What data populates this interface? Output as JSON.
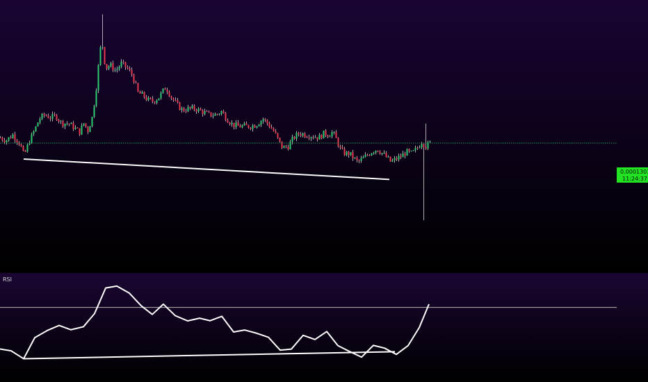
{
  "colors": {
    "bg_top": "#190433",
    "bg_bottom": "#000000",
    "rsi_bg_top": "#1a0633",
    "rsi_bg_bottom": "#000000",
    "up": "#2ecc71",
    "down": "#e8384f",
    "wick": "#d8d8d8",
    "trendline": "#ffffff",
    "price_line": "#2ecc71",
    "badge_bg": "#22e322",
    "rsi_line": "#ffffff",
    "rsi_level": "#b8b8b8"
  },
  "price_pane": {
    "last_price": "0.0001301",
    "countdown": "11:24:37"
  },
  "rsi_pane": {
    "label": "RSI"
  },
  "chart_data": [
    {
      "type": "candlestick",
      "title": "",
      "ylim": [
        9e-05,
        0.000175
      ],
      "x": {
        "first": 0,
        "step": 3,
        "count": 207
      },
      "close_path": [
        [
          0,
          0.0001318
        ],
        [
          8,
          0.0001309
        ],
        [
          18,
          0.0001327
        ],
        [
          28,
          0.00013
        ],
        [
          34,
          0.0001261
        ],
        [
          42,
          0.0001309
        ],
        [
          50,
          0.0001345
        ],
        [
          56,
          0.0001377
        ],
        [
          64,
          0.000139
        ],
        [
          72,
          0.0001381
        ],
        [
          80,
          0.0001386
        ],
        [
          88,
          0.0001363
        ],
        [
          98,
          0.0001363
        ],
        [
          106,
          0.000135
        ],
        [
          114,
          0.0001336
        ],
        [
          120,
          0.0001363
        ],
        [
          126,
          0.0001341
        ],
        [
          132,
          0.0001381
        ],
        [
          137,
          0.0001454
        ],
        [
          142,
          0.0001563
        ],
        [
          146,
          0.0001632
        ],
        [
          148,
          0.0001578
        ],
        [
          152,
          0.0001537
        ],
        [
          158,
          0.0001546
        ],
        [
          166,
          0.0001528
        ],
        [
          174,
          0.0001551
        ],
        [
          182,
          0.0001537
        ],
        [
          190,
          0.0001514
        ],
        [
          198,
          0.0001459
        ],
        [
          206,
          0.000145
        ],
        [
          212,
          0.0001436
        ],
        [
          220,
          0.0001432
        ],
        [
          228,
          0.0001445
        ],
        [
          238,
          0.0001477
        ],
        [
          246,
          0.0001445
        ],
        [
          254,
          0.0001422
        ],
        [
          262,
          0.0001404
        ],
        [
          270,
          0.0001409
        ],
        [
          280,
          0.0001409
        ],
        [
          290,
          0.00014
        ],
        [
          300,
          0.000139
        ],
        [
          310,
          0.000139
        ],
        [
          318,
          0.00014
        ],
        [
          326,
          0.0001377
        ],
        [
          334,
          0.0001359
        ],
        [
          342,
          0.0001354
        ],
        [
          350,
          0.0001354
        ],
        [
          360,
          0.0001354
        ],
        [
          368,
          0.0001359
        ],
        [
          378,
          0.0001377
        ],
        [
          386,
          0.0001359
        ],
        [
          394,
          0.0001336
        ],
        [
          400,
          0.0001309
        ],
        [
          406,
          0.0001286
        ],
        [
          414,
          0.0001291
        ],
        [
          422,
          0.0001318
        ],
        [
          430,
          0.0001332
        ],
        [
          440,
          0.0001327
        ],
        [
          450,
          0.0001323
        ],
        [
          458,
          0.0001318
        ],
        [
          466,
          0.0001332
        ],
        [
          472,
          0.0001327
        ],
        [
          478,
          0.0001336
        ],
        [
          484,
          0.0001309
        ],
        [
          490,
          0.0001277
        ],
        [
          496,
          0.0001268
        ],
        [
          502,
          0.0001268
        ],
        [
          508,
          0.0001255
        ],
        [
          514,
          0.0001241
        ],
        [
          520,
          0.000125
        ],
        [
          528,
          0.0001264
        ],
        [
          536,
          0.0001277
        ],
        [
          542,
          0.0001282
        ],
        [
          550,
          0.0001268
        ],
        [
          556,
          0.0001255
        ],
        [
          562,
          0.0001241
        ],
        [
          568,
          0.000125
        ],
        [
          576,
          0.0001259
        ],
        [
          584,
          0.0001273
        ],
        [
          592,
          0.0001268
        ],
        [
          600,
          0.0001286
        ],
        [
          606,
          0.0001305
        ],
        [
          612,
          0.0001291
        ],
        [
          618,
          0.0001301
        ]
      ],
      "extreme_wicks": [
        {
          "x": 147,
          "high": 0.0001705
        },
        {
          "x": 610,
          "low": 0.0001059
        },
        {
          "x": 613,
          "high": 0.0001362
        }
      ],
      "trendline": {
        "x": [
          34,
          560
        ],
        "y": [
          0.0001251,
          0.0001187
        ]
      },
      "last_price_line": 0.0001301
    },
    {
      "type": "line",
      "title": "RSI",
      "ylim": [
        0,
        100
      ],
      "x": [
        0,
        16,
        34,
        50,
        68,
        85,
        102,
        120,
        136,
        152,
        168,
        186,
        203,
        219,
        235,
        252,
        270,
        287,
        302,
        319,
        336,
        352,
        369,
        386,
        403,
        419,
        436,
        453,
        470,
        486,
        503,
        520,
        537,
        553,
        570,
        587,
        603,
        617
      ],
      "values": [
        25.8,
        23.9,
        15.5,
        37.9,
        45.5,
        50.9,
        46.3,
        49.5,
        63.5,
        90.7,
        92.7,
        85.2,
        71.8,
        62.6,
        73.5,
        61.3,
        55.7,
        58.6,
        55.9,
        60.6,
        43.9,
        46.0,
        42.6,
        38.3,
        24.6,
        25.7,
        40.4,
        35.9,
        44.4,
        29.4,
        23.1,
        17.2,
        29.7,
        26.8,
        20.1,
        29.5,
        48.6,
        73.5
      ],
      "levels": [
        70,
        30
      ],
      "visible_levels": [
        70
      ],
      "trendline": {
        "x": [
          34,
          568
        ],
        "y": [
          15.5,
          23.0
        ]
      }
    }
  ]
}
